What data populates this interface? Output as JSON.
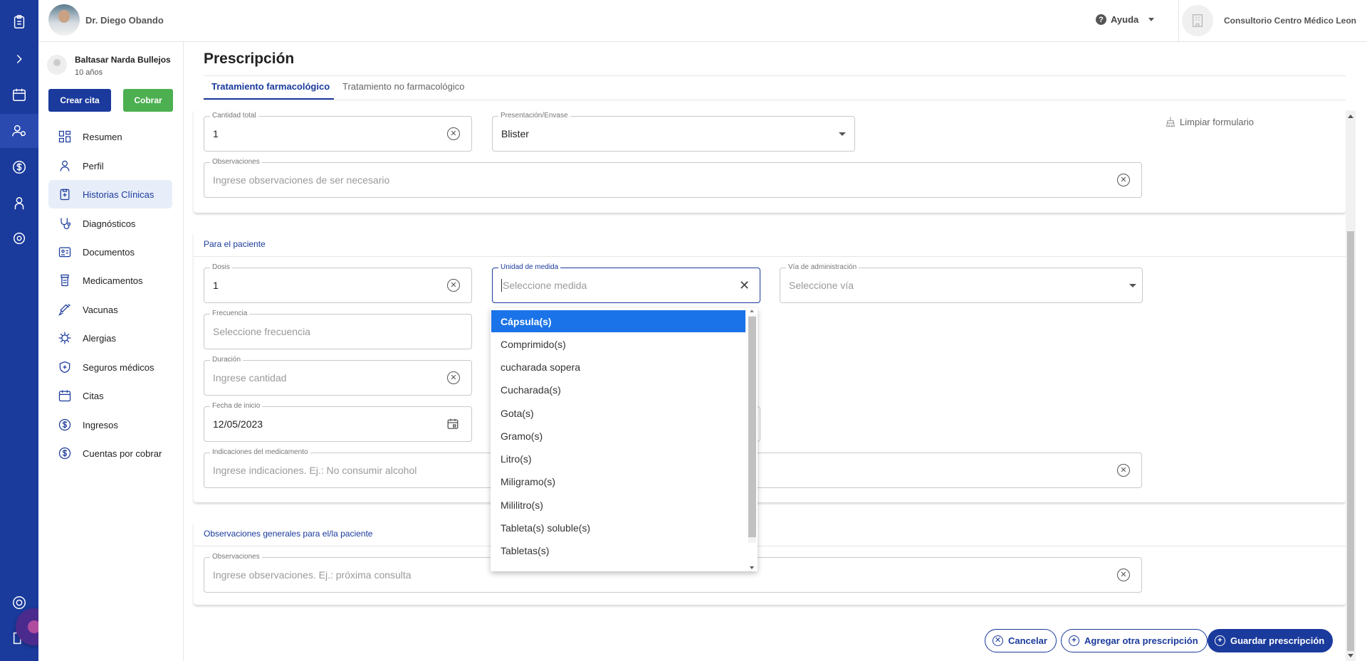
{
  "topbar": {
    "doctor_name": "Dr. Diego Obando",
    "help_label": "Ayuda",
    "clinic_name": "Consultorio Centro Médico Leon"
  },
  "patient": {
    "name": "Baltasar Narda Bullejos",
    "age": "10 años"
  },
  "sidebar": {
    "crear_cita": "Crear cita",
    "cobrar": "Cobrar",
    "items": [
      {
        "label": "Resumen",
        "icon": "grid-icon"
      },
      {
        "label": "Perfil",
        "icon": "user-icon"
      },
      {
        "label": "Historias Clínicas",
        "icon": "clipboard-icon"
      },
      {
        "label": "Diagnósticos",
        "icon": "stethoscope-icon"
      },
      {
        "label": "Documentos",
        "icon": "document-icon"
      },
      {
        "label": "Medicamentos",
        "icon": "pill-bottle-icon"
      },
      {
        "label": "Vacunas",
        "icon": "syringe-icon"
      },
      {
        "label": "Alergias",
        "icon": "virus-icon"
      },
      {
        "label": "Seguros médicos",
        "icon": "shield-icon"
      },
      {
        "label": "Citas",
        "icon": "calendar-icon"
      },
      {
        "label": "Ingresos",
        "icon": "dollar-icon"
      },
      {
        "label": "Cuentas por cobrar",
        "icon": "dollar-icon"
      }
    ]
  },
  "page": {
    "title": "Prescripción",
    "tabs": [
      "Tratamiento farmacológico",
      "Tratamiento no farmacológico"
    ],
    "limpiar": "Limpiar formulario"
  },
  "section1": {
    "cantidad_total": {
      "label": "Cantidad total",
      "value": "1"
    },
    "presentacion": {
      "label": "Presentación/Envase",
      "value": "Blister"
    },
    "observaciones": {
      "label": "Observaciones",
      "placeholder": "Ingrese observaciones de ser necesario"
    }
  },
  "section2": {
    "title": "Para el paciente",
    "dosis": {
      "label": "Dosis",
      "value": "1"
    },
    "unidad": {
      "label": "Unidad de medida",
      "placeholder": "Seleccione medida"
    },
    "via": {
      "label": "Vía de administración",
      "placeholder": "Seleccione vía"
    },
    "frecuencia": {
      "label": "Frecuencia",
      "placeholder": "Seleccione frecuencia"
    },
    "duracion": {
      "label": "Duración",
      "placeholder": "Ingrese cantidad"
    },
    "fecha_inicio": {
      "label": "Fecha de inicio",
      "value": "12/05/2023"
    },
    "indicaciones": {
      "label": "Indicaciones del medicamento",
      "placeholder": "Ingrese indicaciones. Ej.: No consumir alcohol"
    }
  },
  "section3": {
    "title": "Observaciones generales para el/la paciente",
    "observaciones": {
      "label": "Observaciones",
      "placeholder": "Ingrese observaciones. Ej.: próxima consulta"
    }
  },
  "dropdown": {
    "options": [
      "Cápsula(s)",
      "Comprimido(s)",
      "cucharada sopera",
      "Cucharada(s)",
      "Gota(s)",
      "Gramo(s)",
      "Litro(s)",
      "Miligramo(s)",
      "Mililitro(s)",
      "Tableta(s) soluble(s)",
      "Tabletas(s)"
    ],
    "selected_index": 0
  },
  "actions": {
    "cancelar": "Cancelar",
    "agregar": "Agregar otra prescripción",
    "guardar": "Guardar prescripción"
  },
  "colors": {
    "primary": "#1a3a9c",
    "success": "#4caf50",
    "selected_option": "#1a73e8"
  }
}
